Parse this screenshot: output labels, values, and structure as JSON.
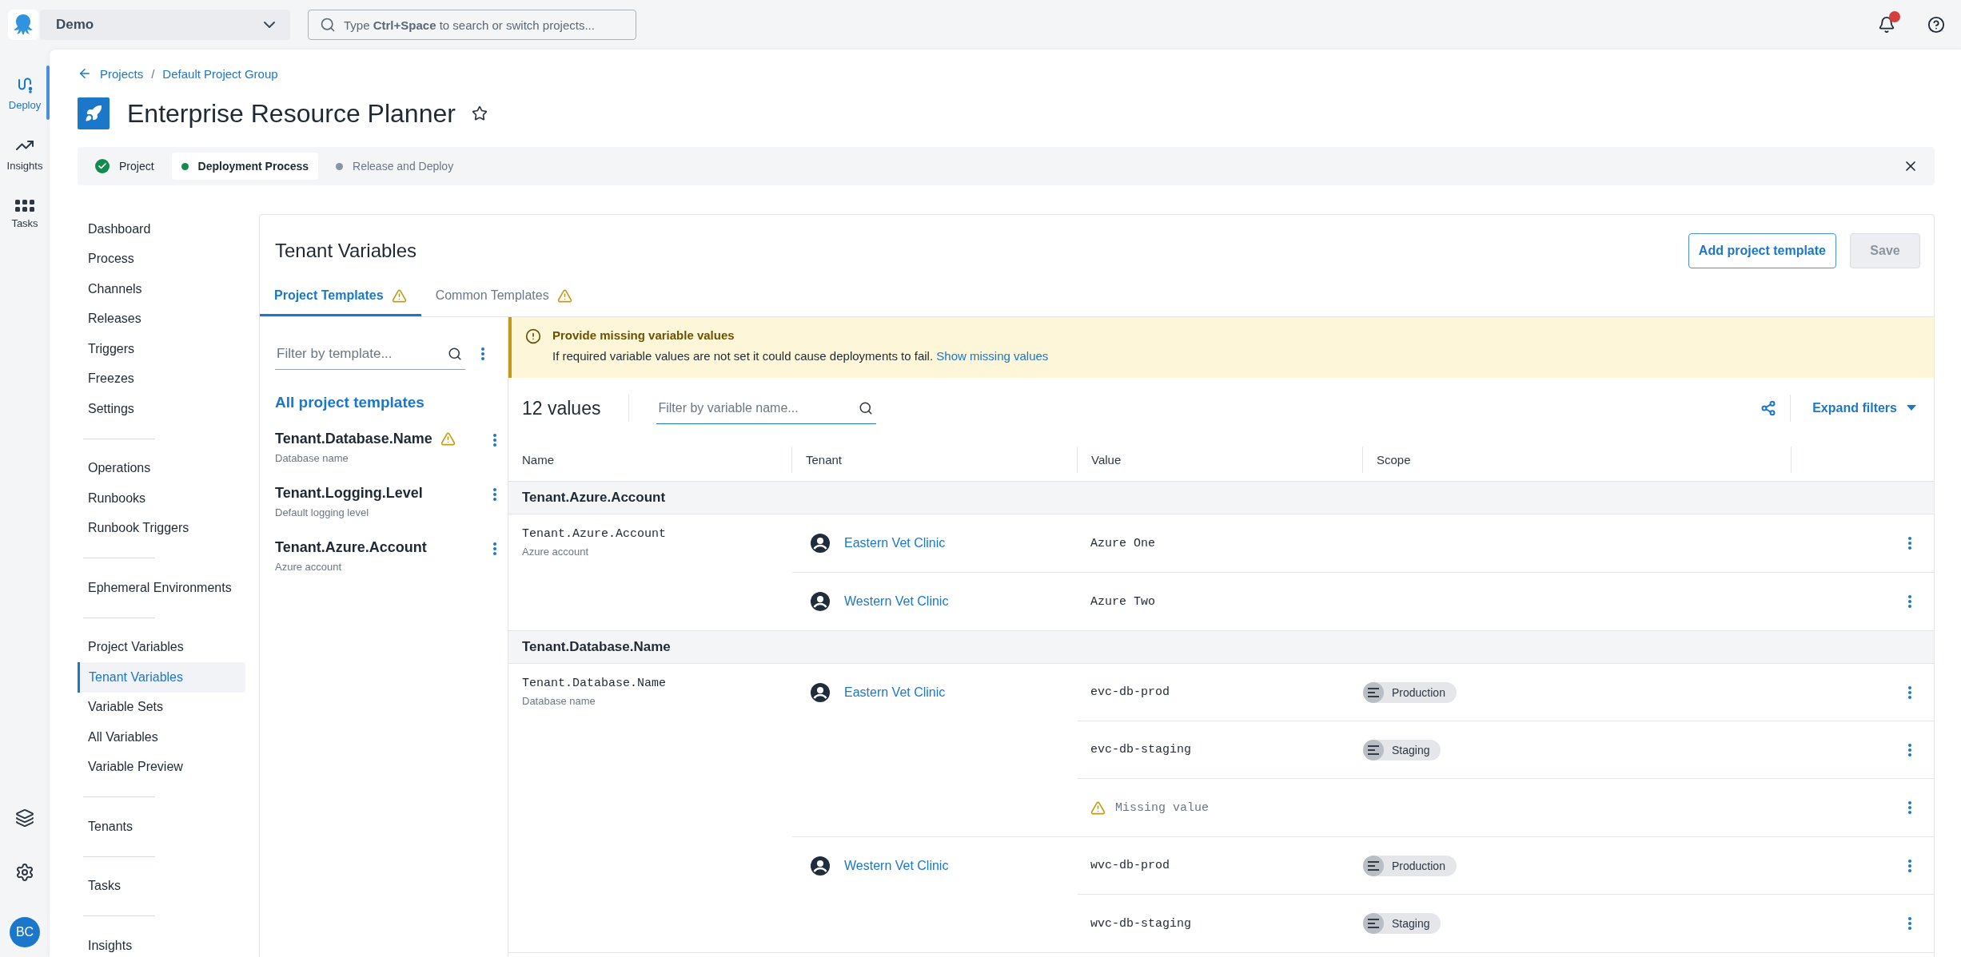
{
  "top_bar": {
    "space": "Demo",
    "search": {
      "placeholder": "Type **Ctrl+Space** to search or switch projects..."
    },
    "has_notifications": true
  },
  "rail": {
    "items": [
      {
        "label": "Deploy",
        "kind": "deploy",
        "selected": true
      },
      {
        "label": "Insights",
        "kind": "insights",
        "selected": false
      },
      {
        "label": "Tasks",
        "kind": "tasks",
        "selected": false
      }
    ],
    "avatar": "BC"
  },
  "breadcrumb": {
    "items": [
      "Projects",
      "Default Project Group"
    ],
    "separator": "/"
  },
  "project": {
    "title": "Enterprise Resource Planner",
    "starred": false
  },
  "stepper": [
    {
      "label": "Project",
      "completed": true,
      "selected": false
    },
    {
      "label": "Deployment Process",
      "completed": false,
      "selected": true
    },
    {
      "label": "Release and Deploy",
      "completed": false,
      "selected": false
    }
  ],
  "nav": [
    [
      {
        "label": "Dashboard",
        "selected": false
      },
      {
        "label": "Process",
        "selected": false
      },
      {
        "label": "Channels",
        "selected": false
      },
      {
        "label": "Releases",
        "selected": false
      },
      {
        "label": "Triggers",
        "selected": false
      },
      {
        "label": "Freezes",
        "selected": false
      },
      {
        "label": "Settings",
        "selected": false
      }
    ],
    [
      {
        "label": "Operations",
        "selected": false
      },
      {
        "label": "Runbooks",
        "selected": false
      },
      {
        "label": "Runbook Triggers",
        "selected": false
      }
    ],
    [
      {
        "label": "Ephemeral Environments",
        "selected": false
      }
    ],
    [
      {
        "label": "Project Variables",
        "selected": false
      },
      {
        "label": "Tenant Variables",
        "selected": true
      },
      {
        "label": "Variable Sets",
        "selected": false
      },
      {
        "label": "All Variables",
        "selected": false
      },
      {
        "label": "Variable Preview",
        "selected": false
      }
    ],
    [
      {
        "label": "Tenants",
        "selected": false
      }
    ],
    [
      {
        "label": "Tasks",
        "selected": false
      }
    ],
    [
      {
        "label": "Insights",
        "selected": false
      }
    ]
  ],
  "panel": {
    "title": "Tenant Variables",
    "add_button": "Add project template",
    "save_button": {
      "label": "Save",
      "disabled": true
    },
    "tabs": [
      {
        "label": "Project Templates",
        "selected": true,
        "warning": true
      },
      {
        "label": "Common Templates",
        "selected": false,
        "warning": true
      }
    ],
    "templates": {
      "filter": {
        "placeholder": "Filter by template..."
      },
      "all_label": "All project templates",
      "items": [
        {
          "name": "Tenant.Database.Name",
          "description": "Database name",
          "warning": true
        },
        {
          "name": "Tenant.Logging.Level",
          "description": "Default logging level",
          "warning": false
        },
        {
          "name": "Tenant.Azure.Account",
          "description": "Azure account",
          "warning": false
        }
      ]
    },
    "banner": {
      "title": "Provide missing variable values",
      "text": "If required variable values are not set it could cause deployments to fail.",
      "link": "Show missing values"
    },
    "values": {
      "count": "12 values",
      "filter": {
        "placeholder": "Filter by variable name..."
      },
      "expand": "Expand filters"
    },
    "table": {
      "columns": [
        "Name",
        "Tenant",
        "Value",
        "Scope"
      ],
      "groups": [
        {
          "title": "Tenant.Azure.Account",
          "name": "Tenant.Azure.Account",
          "description": "Azure account",
          "tenants": [
            {
              "name": "Eastern Vet Clinic",
              "values": [
                {
                  "kind": "value",
                  "value": "Azure One"
                }
              ]
            },
            {
              "name": "Western Vet Clinic",
              "values": [
                {
                  "kind": "value",
                  "value": "Azure Two"
                }
              ]
            }
          ]
        },
        {
          "title": "Tenant.Database.Name",
          "name": "Tenant.Database.Name",
          "description": "Database name",
          "tenants": [
            {
              "name": "Eastern Vet Clinic",
              "values": [
                {
                  "kind": "value",
                  "value": "evc-db-prod",
                  "scope": "Production"
                },
                {
                  "kind": "value",
                  "value": "evc-db-staging",
                  "scope": "Staging"
                },
                {
                  "kind": "missing",
                  "value": "Missing value"
                }
              ]
            },
            {
              "name": "Western Vet Clinic",
              "values": [
                {
                  "kind": "value",
                  "value": "wvc-db-prod",
                  "scope": "Production"
                },
                {
                  "kind": "value",
                  "value": "wvc-db-staging",
                  "scope": "Staging"
                }
              ]
            }
          ]
        }
      ]
    }
  }
}
